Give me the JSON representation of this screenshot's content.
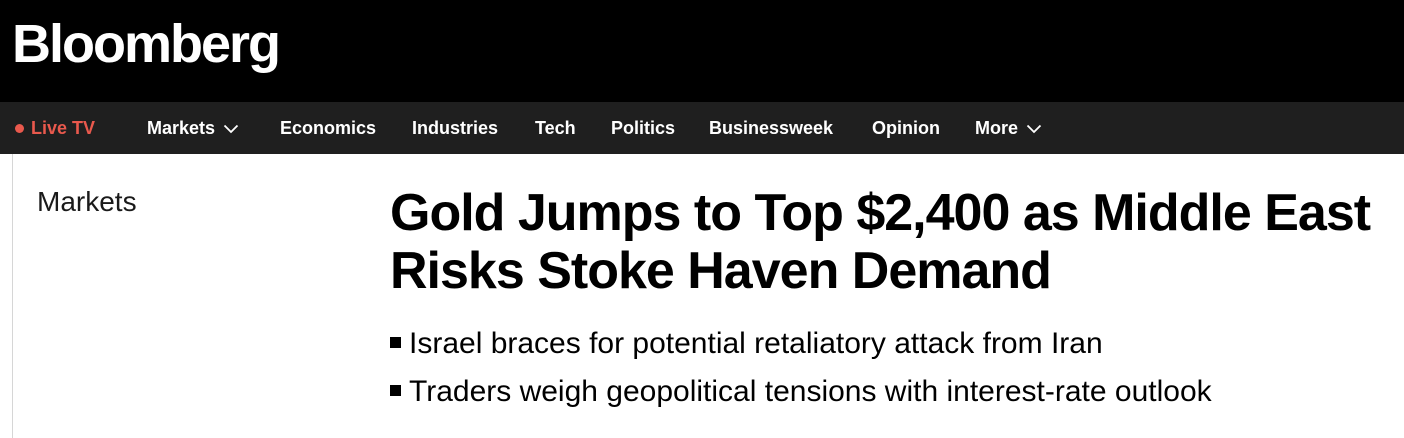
{
  "header": {
    "logo_text": "Bloomberg"
  },
  "nav": {
    "live_label": "Live TV",
    "items": [
      {
        "label": "Markets",
        "has_dropdown": true
      },
      {
        "label": "Economics",
        "has_dropdown": false
      },
      {
        "label": "Industries",
        "has_dropdown": false
      },
      {
        "label": "Tech",
        "has_dropdown": false
      },
      {
        "label": "Politics",
        "has_dropdown": false
      },
      {
        "label": "Businessweek",
        "has_dropdown": false
      },
      {
        "label": "Opinion",
        "has_dropdown": false
      },
      {
        "label": "More",
        "has_dropdown": true
      }
    ]
  },
  "article": {
    "section": "Markets",
    "headline": "Gold Jumps to Top $2,400 as Middle East Risks Stoke Haven Demand",
    "bullets": [
      "Israel braces for potential retaliatory attack from Iran",
      "Traders weigh geopolitical tensions with interest-rate outlook"
    ]
  },
  "colors": {
    "topbar_bg": "#000000",
    "navbar_bg": "#1f1f1f",
    "live_accent": "#e9594d",
    "text": "#000000"
  },
  "icons": {
    "live_indicator": "live-dot-icon",
    "dropdown": "chevron-down-icon",
    "bullet": "square-bullet-icon"
  }
}
